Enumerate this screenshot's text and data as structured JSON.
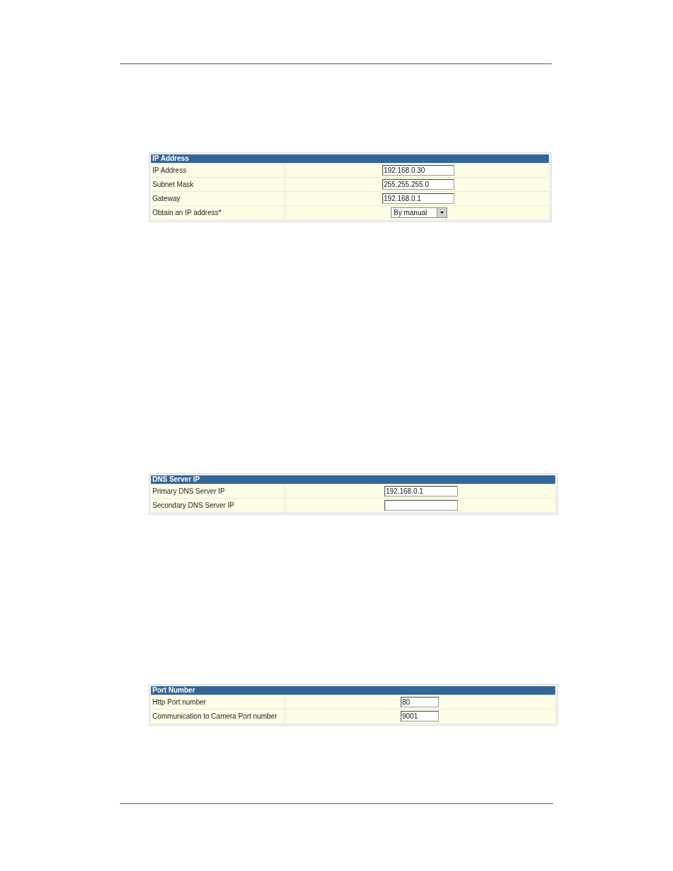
{
  "panels": [
    {
      "title": "IP Address",
      "rows": [
        {
          "kind": "text",
          "label": "IP Address",
          "value": "192.168.0.30"
        },
        {
          "kind": "text",
          "label": "Subnet Mask",
          "value": "255.255.255.0"
        },
        {
          "kind": "text",
          "label": "Gateway",
          "value": "192.168.0.1"
        },
        {
          "kind": "select",
          "label": "Obtain an IP address*",
          "value": "By manual"
        }
      ]
    },
    {
      "title": "DNS Server IP",
      "rows": [
        {
          "kind": "text",
          "label": "Primary DNS Server IP",
          "value": "192.168.0.1"
        },
        {
          "kind": "text",
          "label": "Secondary DNS Server IP"
        }
      ]
    },
    {
      "title": "Port Number",
      "rows": [
        {
          "kind": "text",
          "label": "Http Port number",
          "value": "80"
        },
        {
          "kind": "text",
          "label": "Communication to Camera Port number",
          "value": "9001"
        }
      ]
    }
  ]
}
